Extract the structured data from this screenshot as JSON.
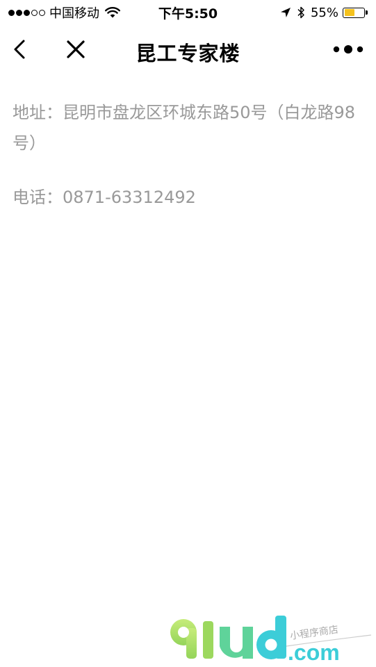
{
  "status_bar": {
    "carrier": "中国移动",
    "time": "下午5:50",
    "battery_percent": "55%",
    "battery_level": 0.55,
    "signal_filled": 3,
    "signal_total": 5
  },
  "nav": {
    "title": "昆工专家楼"
  },
  "info": {
    "address": "地址：昆明市盘龙区环城东路50号（白龙路98号）",
    "phone": "电话：0871-63312492"
  },
  "watermark": {
    "logo": "91ud.com",
    "tagline": "小程序商店"
  },
  "colors": {
    "text_secondary": "#999999",
    "battery": "#f5c21d",
    "logo_green": "#b6e36a",
    "logo_cyan": "#3ccdd8"
  },
  "icons": {
    "back": "chevron-left-icon",
    "close": "close-icon",
    "more": "more-dots-icon",
    "wifi": "wifi-icon",
    "location": "location-arrow-icon",
    "bluetooth": "bluetooth-icon",
    "battery": "battery-icon"
  }
}
